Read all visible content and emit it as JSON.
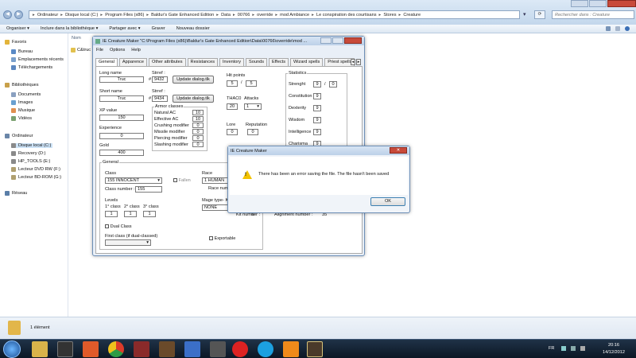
{
  "explorer": {
    "breadcrumbs": [
      "Ordinateur",
      "Disque local (C:)",
      "Program Files (x86)",
      "Baldur's Gate Enhanced Edition",
      "Data",
      "00766",
      "override",
      "mod Ambiance",
      "Le conspiration des courtisans",
      "Stores",
      "Creature"
    ],
    "search_placeholder": "Rechercher dans : Creature",
    "commands": [
      "Organiser ▾",
      "Inclure dans la bibliothèque ▾",
      "Partager avec ▾",
      "Graver",
      "Nouveau dossier"
    ],
    "nav": [
      {
        "label": "Favoris",
        "icon": "star-icon"
      },
      {
        "label": "Bureau",
        "icon": "desktop-icon"
      },
      {
        "label": "Emplacements récents",
        "icon": "recent-icon"
      },
      {
        "label": "Téléchargements",
        "icon": "download-icon"
      },
      {
        "label": "Bibliothèques",
        "icon": "library-icon"
      },
      {
        "label": "Documents",
        "icon": "document-icon"
      },
      {
        "label": "Images",
        "icon": "image-icon"
      },
      {
        "label": "Musique",
        "icon": "music-icon"
      },
      {
        "label": "Vidéos",
        "icon": "video-icon"
      },
      {
        "label": "Ordinateur",
        "icon": "computer-icon"
      },
      {
        "label": "Disque local (C:)",
        "icon": "drive-icon"
      },
      {
        "label": "Recovery (D:)",
        "icon": "drive-icon"
      },
      {
        "label": "HP_TOOLS (E:)",
        "icon": "drive-icon"
      },
      {
        "label": "Lecteur DVD RW (F:)",
        "icon": "dvd-icon"
      },
      {
        "label": "Lecteur BD-ROM (G:)",
        "icon": "dvd-icon"
      },
      {
        "label": "Réseau",
        "icon": "network-icon"
      }
    ],
    "column_name": "Nom",
    "file": "C&truc",
    "status": "1 élément",
    "clock_time": "20:16",
    "clock_date": "14/12/2012",
    "lang": "FR"
  },
  "editor": {
    "title": "IE Creature Maker \"C:\\Program Files (x86)\\Baldur's Gate Enhanced Edition\\Data\\00766\\override\\mod ...",
    "menu": [
      "File",
      "Options",
      "Help"
    ],
    "tabs": [
      "General",
      "Apparence",
      "Other attributes",
      "Resistances",
      "Inventory",
      "Sounds",
      "Effects",
      "Wizard spells",
      "Priest spells"
    ],
    "long_name_label": "Long name",
    "long_name": "Truc",
    "strref_label": "Strref :",
    "strref1": "9432",
    "strref2": "9434",
    "update_label": "Update dialog.tlk",
    "short_name_label": "Short name",
    "short_name": "Truc",
    "xp_label": "XP value",
    "xp": "150",
    "exp_label": "Experience",
    "exp": "0",
    "gold_label": "Gold",
    "gold": "400",
    "armor_title": "Armor classes",
    "armor": [
      {
        "label": "Natural AC",
        "value": "10"
      },
      {
        "label": "Effective AC",
        "value": "10"
      },
      {
        "label": "Crushing modifier",
        "value": "0"
      },
      {
        "label": "Missile modifier",
        "value": "0"
      },
      {
        "label": "Piercing modifier",
        "value": "0"
      },
      {
        "label": "Slashing modifier",
        "value": "0"
      }
    ],
    "hp_label": "Hit points",
    "hp_cur": "5",
    "hp_max": "5",
    "thaco_label": "THAC0",
    "thaco": "20",
    "attacks_label": "Attacks",
    "attacks": "1",
    "lore_label": "Lore",
    "lore": "0",
    "rep_label": "Reputation",
    "rep": "0",
    "stats_title": "Statistics",
    "stats": [
      {
        "label": "Strenght",
        "value": "9",
        "extra": "0"
      },
      {
        "label": "Constitution",
        "value": "9"
      },
      {
        "label": "Dexterity",
        "value": "9"
      },
      {
        "label": "Wisdom",
        "value": "9"
      },
      {
        "label": "Intelligence",
        "value": "9"
      },
      {
        "label": "Charisma",
        "value": "9"
      }
    ],
    "general_title": "General",
    "class_label": "Class",
    "class_value": "155 INNOCENT",
    "fallen_label": "Fallen",
    "class_number_label": "Class number :",
    "class_number": "155",
    "levels_label": "Levels",
    "level_labels": [
      "1° class",
      "2° class",
      "3° class"
    ],
    "levels": [
      "1",
      "1",
      "1"
    ],
    "dual_label": "Dual Class",
    "first_class_label": "First class (if dual-classed)",
    "race_label": "Race",
    "race_value": "1 HUMAN",
    "race_number_label": "Race numb",
    "mage_label": "Mage type- Kit",
    "mage_value": "NONE",
    "kit_label": "Kit number :",
    "kit": "0",
    "align_label": "Alignment number :",
    "align": "35",
    "exportable_label": "Exportable"
  },
  "dialog": {
    "title": "IE Creature Maker",
    "message": "There has been an error saving the file. The file hasn't been saved",
    "ok": "OK"
  }
}
